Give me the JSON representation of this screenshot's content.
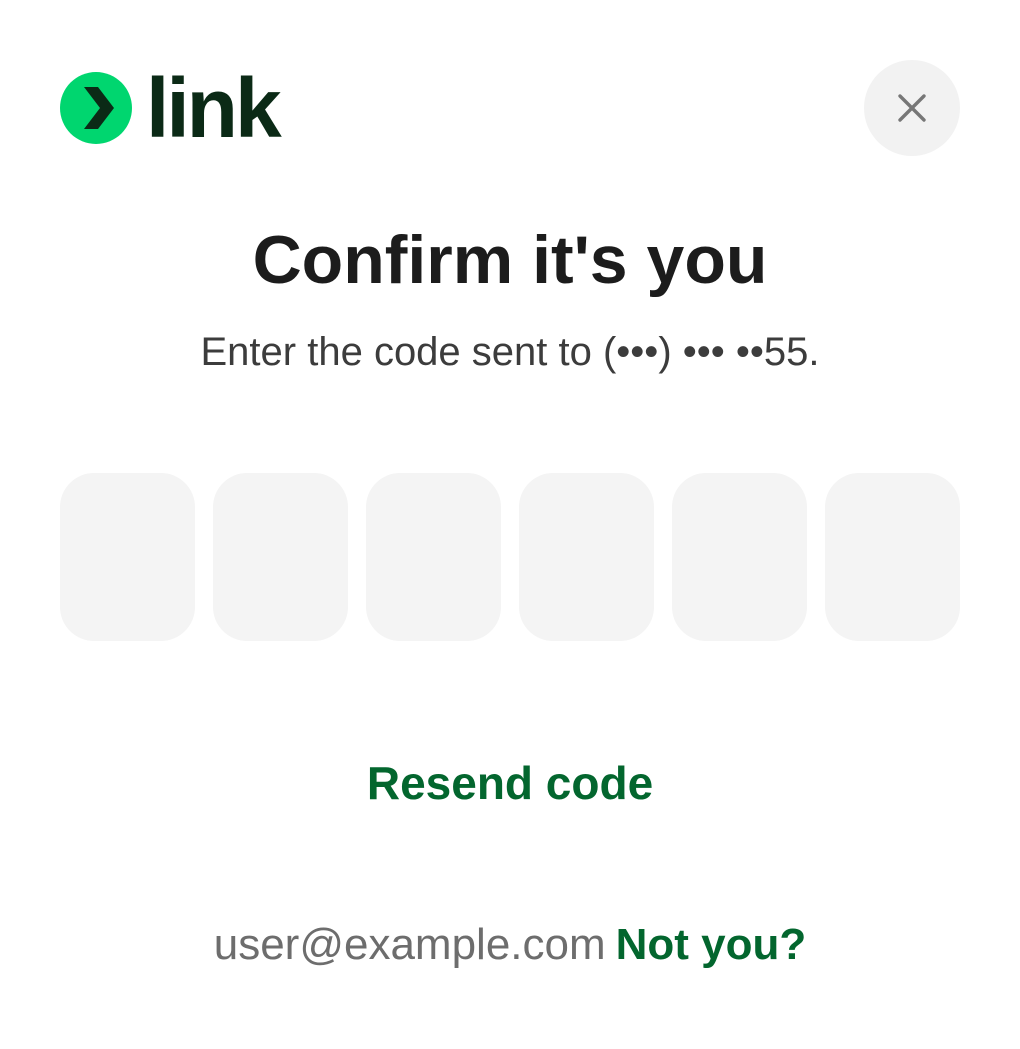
{
  "brand": {
    "wordmark": "link",
    "logo_icon": "link-chevron-logo",
    "green": "#00d66f",
    "dark": "#0b2a16"
  },
  "close_button": {
    "icon": "close-icon"
  },
  "title": "Confirm it's you",
  "subtitle": "Enter the code sent to (•••) ••• ••55.",
  "otp": {
    "digits": [
      "",
      "",
      "",
      "",
      "",
      ""
    ]
  },
  "resend_label": "Resend code",
  "footer": {
    "email": "user@example.com",
    "not_you_label": "Not you?"
  },
  "colors": {
    "accent": "#03662e",
    "input_bg": "#f4f4f4",
    "close_bg": "#f2f2f2"
  }
}
